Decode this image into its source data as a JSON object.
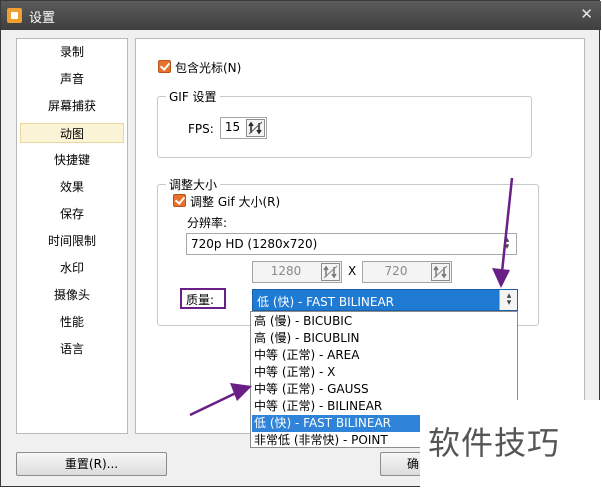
{
  "window": {
    "title": "设置",
    "close_glyph": "✕"
  },
  "sidebar": {
    "items": [
      {
        "label": "录制",
        "selected": false
      },
      {
        "label": "声音",
        "selected": false
      },
      {
        "label": "屏幕捕获",
        "selected": false
      },
      {
        "label": "动图",
        "selected": true
      },
      {
        "label": "快捷键",
        "selected": false
      },
      {
        "label": "效果",
        "selected": false
      },
      {
        "label": "保存",
        "selected": false
      },
      {
        "label": "时间限制",
        "selected": false
      },
      {
        "label": "水印",
        "selected": false
      },
      {
        "label": "摄像头",
        "selected": false
      },
      {
        "label": "性能",
        "selected": false
      },
      {
        "label": "语言",
        "selected": false
      }
    ]
  },
  "main": {
    "include_cursor": {
      "label": "包含光标(N)",
      "checked": true
    },
    "gif_settings": {
      "legend": "GIF 设置",
      "fps_label": "FPS:",
      "fps_value": "15"
    },
    "resize": {
      "legend": "调整大小",
      "resize_gif": {
        "label": "调整 Gif 大小(R)",
        "checked": true
      },
      "resolution_label": "分辨率:",
      "resolution_value": "720p HD (1280x720)",
      "width_value": "1280",
      "x_label": "X",
      "height_value": "720",
      "quality_label": "质量:",
      "quality_value": "低 (快) - FAST BILINEAR"
    },
    "quality_options": [
      {
        "label": "高 (慢) - BICUBIC",
        "selected": false
      },
      {
        "label": "高 (慢) - BICUBLIN",
        "selected": false
      },
      {
        "label": "中等 (正常) - AREA",
        "selected": false
      },
      {
        "label": "中等 (正常) - X",
        "selected": false
      },
      {
        "label": "中等 (正常) - GAUSS",
        "selected": false
      },
      {
        "label": "中等 (正常) - BILINEAR",
        "selected": false
      },
      {
        "label": "低 (快) - FAST BILINEAR",
        "selected": true
      },
      {
        "label": "非常低 (非常快) - POINT",
        "selected": false
      }
    ]
  },
  "footer": {
    "reset_label": "重置(R)...",
    "ok_label": "确"
  },
  "watermark": {
    "text": "软件技巧"
  },
  "colors": {
    "accent": "#1f7ad4",
    "checkbox": "#e8712c",
    "annotation": "#6a1f86",
    "selected_nav": "#fbf3d6"
  },
  "icons": {
    "app": "app-logo-icon",
    "close": "close-icon",
    "spin": "spinner-arrows-icon",
    "dropdown": "chevron-down-icon"
  }
}
